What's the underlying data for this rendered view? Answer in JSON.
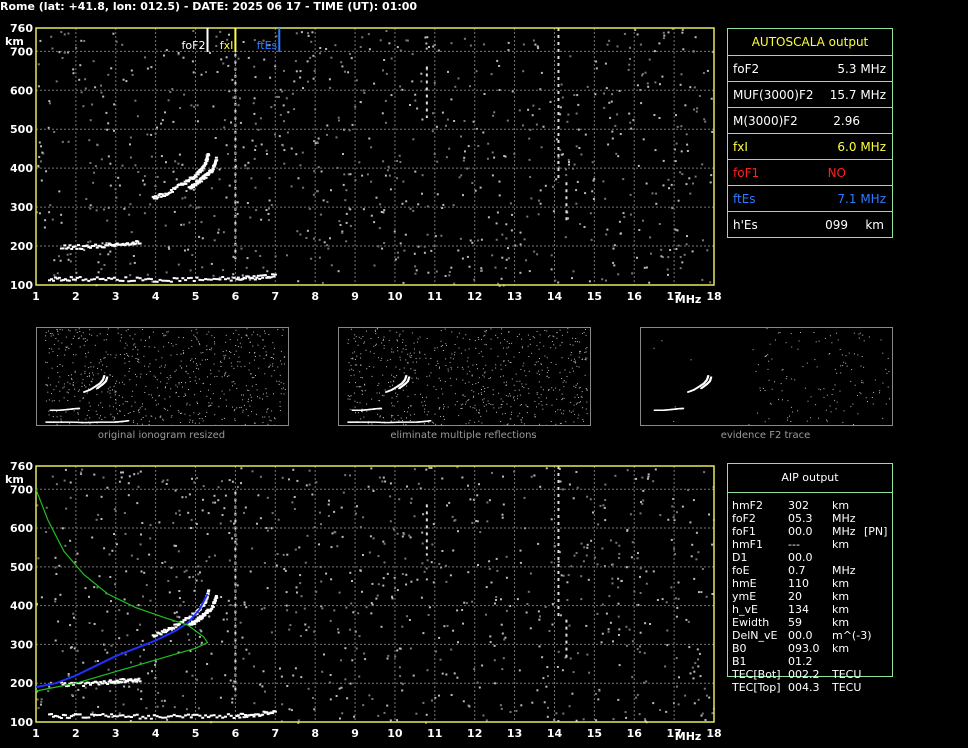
{
  "header": "Rome (lat: +41.8, lon: 012.5) - DATE: 2025 06 17 - TIME (UT): 01:00",
  "axes": {
    "y_unit": "km",
    "x_unit": "MHz",
    "y_ticks": [
      "100",
      "200",
      "300",
      "400",
      "500",
      "600",
      "700",
      "760"
    ],
    "x_ticks": [
      "1",
      "2",
      "3",
      "4",
      "5",
      "6",
      "7",
      "8",
      "9",
      "10",
      "11",
      "12",
      "13",
      "14",
      "15",
      "16",
      "17",
      "18"
    ]
  },
  "markers": {
    "fof2": {
      "label": "foF2",
      "freq": 5.3,
      "color": "#ffffff"
    },
    "fxi": {
      "label": "fxI",
      "freq": 6.0,
      "color": "#ffff40"
    },
    "ftes": {
      "label": "ftEs",
      "freq": 7.1,
      "color": "#2f7bff"
    }
  },
  "autoscala": {
    "title": "AUTOSCALA output",
    "rows": [
      {
        "name": "foF2",
        "value": "5.3 MHz",
        "color": "#ffffff"
      },
      {
        "name": "MUF(3000)F2",
        "value": "15.7 MHz",
        "color": "#ffffff"
      },
      {
        "name": "M(3000)F2",
        "value": "2.96",
        "color": "#ffffff"
      },
      {
        "name": "fxI",
        "value": "6.0 MHz",
        "color": "#ffff40"
      },
      {
        "name": "foF1",
        "value": "NO",
        "color": "#ff2020"
      },
      {
        "name": "ftEs",
        "value": "7.1 MHz",
        "color": "#2f7bff"
      },
      {
        "name": "h'Es",
        "value": "099",
        "unit": "km",
        "color": "#ffffff"
      }
    ]
  },
  "thumbnails": [
    {
      "caption": "original ionogram resized"
    },
    {
      "caption": "eliminate multiple reflections"
    },
    {
      "caption": "evidence F2 trace"
    }
  ],
  "aip": {
    "title": "AIP output",
    "rows": [
      {
        "name": "hmF2",
        "value": "302",
        "unit": "km",
        "extra": ""
      },
      {
        "name": "foF2",
        "value": "05.3",
        "unit": "MHz",
        "extra": ""
      },
      {
        "name": "foF1",
        "value": "00.0",
        "unit": "MHz",
        "extra": "[PN]"
      },
      {
        "name": "hmF1",
        "value": "---",
        "unit": "km",
        "extra": ""
      },
      {
        "name": "D1",
        "value": "00.0",
        "unit": "",
        "extra": ""
      },
      {
        "name": "foE",
        "value": "0.7",
        "unit": "MHz",
        "extra": ""
      },
      {
        "name": "hmE",
        "value": "110",
        "unit": "km",
        "extra": ""
      },
      {
        "name": "ymE",
        "value": "20",
        "unit": "km",
        "extra": ""
      },
      {
        "name": "h_vE",
        "value": "134",
        "unit": "km",
        "extra": ""
      },
      {
        "name": "Ewidth",
        "value": "59",
        "unit": "km",
        "extra": ""
      },
      {
        "name": "DelN_vE",
        "value": "00.0",
        "unit": "m^(-3)",
        "extra": ""
      },
      {
        "name": "B0",
        "value": "093.0",
        "unit": "km",
        "extra": ""
      },
      {
        "name": "B1",
        "value": "01.2",
        "unit": "",
        "extra": ""
      },
      {
        "name": "TEC[Bot]",
        "value": "002.2",
        "unit": "TECU",
        "extra": ""
      },
      {
        "name": "TEC[Top]",
        "value": "004.3",
        "unit": "TECU",
        "extra": ""
      }
    ]
  },
  "chart_data": [
    {
      "type": "scatter",
      "title": "",
      "xlabel": "MHz",
      "ylabel": "km",
      "xlim": [
        1,
        18
      ],
      "ylim": [
        100,
        760
      ],
      "grid": true,
      "series": [
        {
          "values": [
            [
              1.3,
              118
            ],
            [
              2,
              118
            ],
            [
              3,
              118
            ],
            [
              4,
              115
            ],
            [
              5,
              118
            ],
            [
              6,
              118
            ],
            [
              6.5,
              122
            ],
            [
              7,
              128
            ]
          ]
        },
        {
          "values": [
            [
              1.6,
              200
            ],
            [
              2.2,
              200
            ],
            [
              2.8,
              205
            ],
            [
              3.2,
              210
            ],
            [
              3.6,
              212
            ]
          ]
        },
        {
          "values": [
            [
              3.9,
              325
            ],
            [
              4.3,
              340
            ],
            [
              4.7,
              365
            ],
            [
              5.0,
              385
            ],
            [
              5.2,
              410
            ],
            [
              5.3,
              440
            ]
          ]
        },
        {
          "values": [
            [
              4.8,
              350
            ],
            [
              5.0,
              365
            ],
            [
              5.2,
              380
            ],
            [
              5.4,
              400
            ],
            [
              5.5,
              430
            ]
          ]
        }
      ]
    },
    {
      "type": "line",
      "title": "",
      "xlabel": "MHz",
      "ylabel": "km",
      "xlim": [
        1,
        18
      ],
      "ylim": [
        100,
        760
      ],
      "grid": true,
      "series": [
        {
          "color": "#2030ff",
          "values": [
            [
              1.0,
              190
            ],
            [
              1.5,
              200
            ],
            [
              2.0,
              220
            ],
            [
              2.5,
              245
            ],
            [
              3.0,
              270
            ],
            [
              3.5,
              290
            ],
            [
              4.0,
              310
            ],
            [
              4.5,
              335
            ],
            [
              4.8,
              355
            ],
            [
              5.1,
              390
            ],
            [
              5.3,
              430
            ]
          ]
        },
        {
          "color": "#20c020",
          "values": [
            [
              1.0,
              700
            ],
            [
              1.3,
              620
            ],
            [
              1.7,
              540
            ],
            [
              2.2,
              480
            ],
            [
              2.8,
              430
            ],
            [
              3.5,
              395
            ],
            [
              4.2,
              370
            ],
            [
              4.8,
              350
            ],
            [
              5.2,
              320
            ],
            [
              5.3,
              305
            ],
            [
              5.0,
              290
            ],
            [
              4.5,
              275
            ],
            [
              4.0,
              260
            ],
            [
              3.5,
              245
            ],
            [
              3.0,
              230
            ],
            [
              2.5,
              215
            ],
            [
              2.0,
              200
            ],
            [
              1.5,
              190
            ],
            [
              1.0,
              180
            ]
          ]
        }
      ]
    }
  ]
}
